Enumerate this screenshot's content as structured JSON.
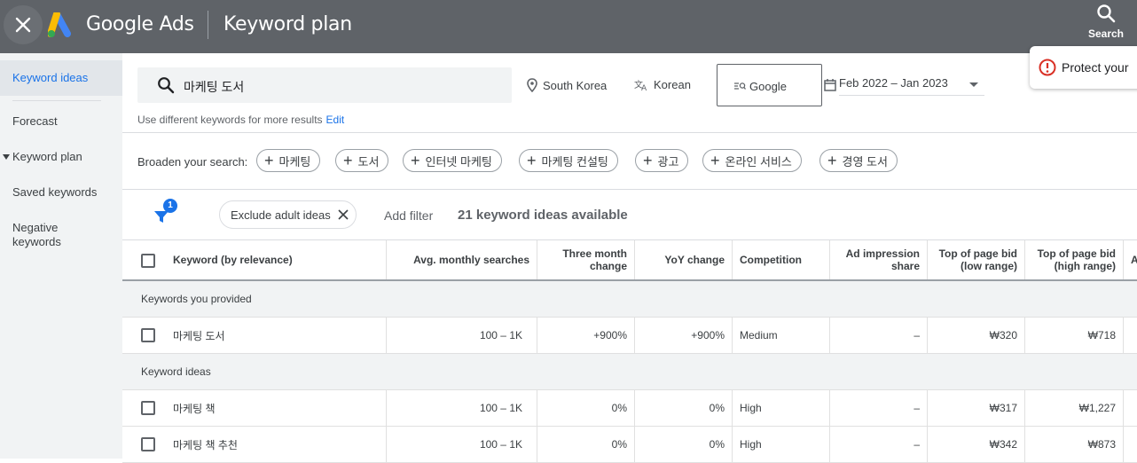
{
  "topbar": {
    "brand": "Google Ads",
    "page_title": "Keyword plan",
    "search_label": "Search"
  },
  "sidebar": {
    "items": [
      {
        "label": "Keyword ideas"
      },
      {
        "label": "Forecast"
      },
      {
        "label": "Keyword plan"
      },
      {
        "label": "Saved keywords"
      },
      {
        "label": "Negative keywords"
      }
    ]
  },
  "search": {
    "query": "마케팅 도서",
    "location": "South Korea",
    "language": "Korean",
    "network": "Google",
    "date_range": "Feb 2022 – Jan 2023",
    "hint": "Use different keywords for more results",
    "edit": "Edit"
  },
  "protect": "Protect your",
  "broaden": {
    "label": "Broaden your search:",
    "chips": [
      "마케팅",
      "도서",
      "인터넷 마케팅",
      "마케팅 컨설팅",
      "광고",
      "온라인 서비스",
      "경영 도서"
    ]
  },
  "filters": {
    "badge": "1",
    "exclude_chip": "Exclude adult ideas",
    "add_filter": "Add filter",
    "available": "21 keyword ideas available"
  },
  "table": {
    "headers": {
      "keyword": "Keyword (by relevance)",
      "avg": "Avg. monthly searches",
      "three_month_1": "Three month",
      "three_month_2": "change",
      "yoy": "YoY change",
      "competition": "Competition",
      "ad_impr_1": "Ad impression",
      "ad_impr_2": "share",
      "top_low_1": "Top of page bid",
      "top_low_2": "(low range)",
      "top_high_1": "Top of page bid",
      "top_high_2": "(high range)",
      "extra": "A"
    },
    "group_provided": "Keywords you provided",
    "group_ideas": "Keyword ideas",
    "rows": [
      {
        "keyword": "마케팅 도서",
        "avg": "100 – 1K",
        "three": "+900%",
        "yoy": "+900%",
        "comp": "Medium",
        "impr": "–",
        "low": "₩320",
        "high": "₩718"
      },
      {
        "keyword": "마케팅 책",
        "avg": "100 – 1K",
        "three": "0%",
        "yoy": "0%",
        "comp": "High",
        "impr": "–",
        "low": "₩317",
        "high": "₩1,227"
      },
      {
        "keyword": "마케팅 책 추천",
        "avg": "100 – 1K",
        "three": "0%",
        "yoy": "0%",
        "comp": "High",
        "impr": "–",
        "low": "₩342",
        "high": "₩873"
      }
    ]
  }
}
